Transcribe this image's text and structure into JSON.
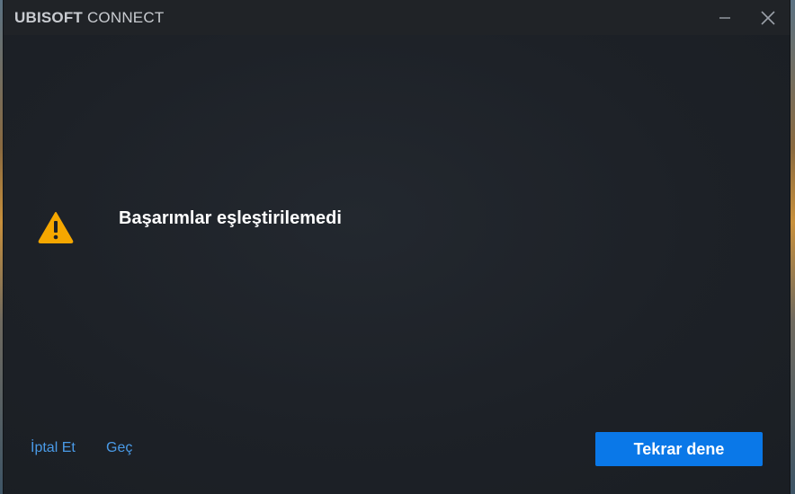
{
  "window": {
    "brand_bold": "UBISOFT",
    "brand_light": "CONNECT",
    "minimize_icon": "minimize-icon",
    "close_icon": "close-icon"
  },
  "dialog": {
    "icon": "warning-icon",
    "icon_color": "#f5a700",
    "message": "Başarımlar eşleştirilemedi",
    "cancel_label": "İptal Et",
    "skip_label": "Geç",
    "retry_label": "Tekrar dene",
    "accent_color": "#0a78e8",
    "link_color": "#4a9be8"
  }
}
